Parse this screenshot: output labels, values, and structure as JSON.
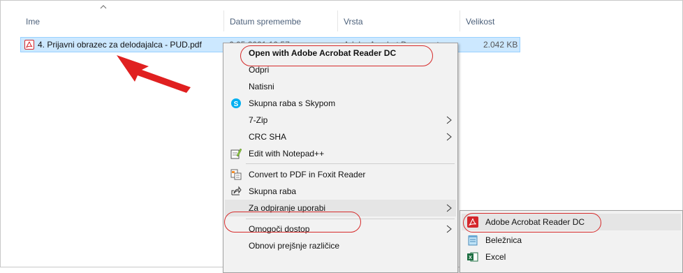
{
  "columns": {
    "name": "Ime",
    "date": "Datum spremembe",
    "type": "Vrsta",
    "size": "Velikost"
  },
  "file": {
    "name": "4. Prijavni obrazec za delodajalca - PUD.pdf",
    "date": "6.05.2021 10:57",
    "type": "Adobe Acrobat Document",
    "size": "2.042 KB"
  },
  "context_menu": {
    "open_with_acrobat": "Open with Adobe Acrobat Reader DC",
    "open": "Odpri",
    "print": "Natisni",
    "share_skype": "Skupna raba s Skypom",
    "seven_zip": "7-Zip",
    "crc_sha": "CRC SHA",
    "edit_notepad": "Edit with Notepad++",
    "convert_foxit": "Convert to PDF in Foxit Reader",
    "share": "Skupna raba",
    "open_with": "Za odpiranje uporabi",
    "give_access": "Omogoči dostop",
    "restore_versions": "Obnovi prejšnje različice"
  },
  "submenu": {
    "acrobat": "Adobe Acrobat Reader DC",
    "notepad": "Beležnica",
    "excel": "Excel"
  },
  "colors": {
    "selection_bg": "#cce8ff",
    "selection_border": "#99d1ff",
    "annotation_red": "#d62a2a",
    "menu_bg": "#f2f2f2"
  }
}
